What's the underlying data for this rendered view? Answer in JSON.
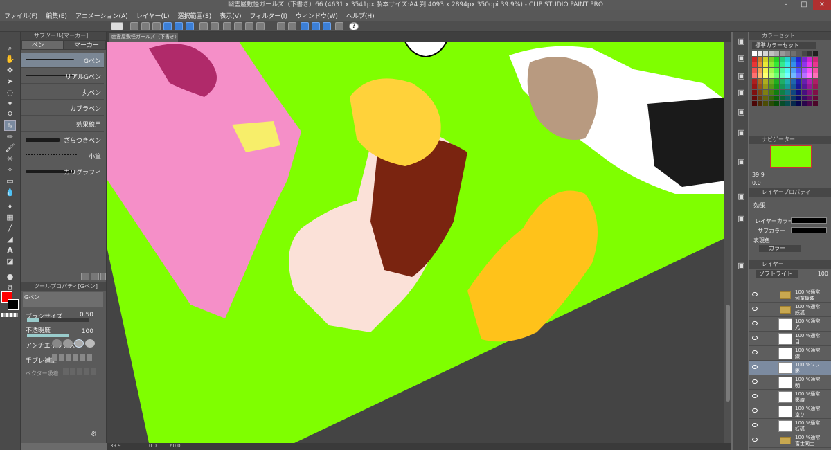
{
  "window": {
    "title": "幽霊屋敷怪ガールズ（下書き）66 (4631 x 3541px 製本サイズ:A4 判 4093 x 2894px 350dpi 39.9%) - CLIP STUDIO PAINT PRO",
    "minimize": "–",
    "maximize": "□",
    "close": "×"
  },
  "menu": {
    "items": [
      "ファイル(F)",
      "編集(E)",
      "アニメーション(A)",
      "レイヤー(L)",
      "選択範囲(S)",
      "表示(V)",
      "フィルター(I)",
      "ウィンドウ(W)",
      "ヘルプ(H)"
    ]
  },
  "document_tab": {
    "label": "幽霊屋敷怪ガールズ（下書き）66"
  },
  "subtool": {
    "header": "サブツール[マーカー]",
    "tabs": [
      "ペン",
      "マーカー"
    ],
    "brushes": [
      "Gペン",
      "リアルGペン",
      "丸ペン",
      "カブラペン",
      "効果線用",
      "ざらつきペン",
      "小筆",
      "カリグラフィ"
    ]
  },
  "tool_property": {
    "header": "ツールプロパティ[Gペン]",
    "brush_name": "Gペン",
    "brush_size_label": "ブラシサイズ",
    "brush_size_value": "0.50",
    "brush_size_fraction": 0.2,
    "opacity_label": "不透明度",
    "opacity_value": "100",
    "opacity_fraction": 1.0,
    "antialias_label": "アンチエイリアス",
    "stabilization_label": "手ブレ補正",
    "vector_label": "ベクター吸着"
  },
  "colors": {
    "main": "#ff0000",
    "sub": "#000000",
    "canvas_bg": "#7fff00",
    "selected_layer": "#7c8ba0"
  },
  "color_set": {
    "header": "カラーセット",
    "set_name": "標準カラーセット"
  },
  "navigator": {
    "header": "ナビゲーター",
    "zoom": "39.9",
    "rotate": "0.0"
  },
  "layer_property": {
    "header": "レイヤープロパティ",
    "effect_label": "効果",
    "layer_color_label": "レイヤーカラー",
    "sub_color_label": "サブカラー",
    "expression_label": "表現色",
    "expression_value": "カラー"
  },
  "layers_panel": {
    "header": "レイヤー",
    "blend_mode": "ソフトライト",
    "opacity": "100",
    "layers": [
      {
        "mode": "100 %通常",
        "name": "河童仮装",
        "folder": true
      },
      {
        "mode": "100 %通常",
        "name": "妖狐",
        "folder": true
      },
      {
        "mode": "100 %通常",
        "name": "光",
        "folder": false
      },
      {
        "mode": "100 %通常",
        "name": "目",
        "folder": false
      },
      {
        "mode": "100 %通常",
        "name": "線",
        "folder": false
      },
      {
        "mode": "100 %ソフ",
        "name": "影",
        "folder": false
      },
      {
        "mode": "100 %通常",
        "name": "明",
        "folder": false
      },
      {
        "mode": "100 %通常",
        "name": "影線",
        "folder": false
      },
      {
        "mode": "100 %通常",
        "name": "塗り",
        "folder": false
      },
      {
        "mode": "100 %通常",
        "name": "妖狐",
        "folder": false
      },
      {
        "mode": "100 %通常",
        "name": "富士同士",
        "folder": true
      }
    ]
  },
  "status": {
    "zoom": "39.9",
    "angle": "0.0",
    "extra": "0",
    "rotate": "60.0"
  },
  "icons": [
    "pen-tool-icon",
    "eraser-icon",
    "text-tool-icon",
    "eye-icon",
    "folder-icon",
    "trash-icon",
    "new-layer-icon",
    "help-icon"
  ]
}
